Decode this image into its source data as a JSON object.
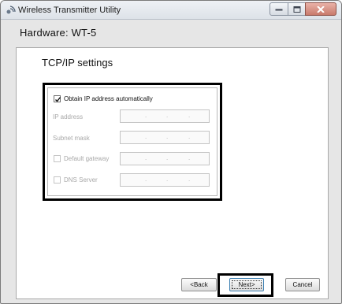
{
  "window": {
    "title": "Wireless Transmitter Utility",
    "app_icon": "wireless-transmitter-icon"
  },
  "header": {
    "hardware_label": "Hardware: WT-5"
  },
  "section": {
    "title": "TCP/IP settings"
  },
  "settings": {
    "obtain_auto": {
      "label": "Obtain IP address automatically",
      "checked": true
    },
    "ip_address": {
      "label": "IP address",
      "enabled": false
    },
    "subnet_mask": {
      "label": "Subnet mask",
      "enabled": false
    },
    "default_gateway": {
      "label": "Default gateway",
      "checked": false,
      "enabled": false
    },
    "dns_server": {
      "label": "DNS Server",
      "checked": false,
      "enabled": false
    }
  },
  "buttons": {
    "back_label": "<Back",
    "next_label": "Next>",
    "cancel_label": "Cancel"
  },
  "colors": {
    "highlight_border": "#000000",
    "disabled_text": "#a8a8a8",
    "panel_background": "#ffffff",
    "window_background": "#e6e6e6"
  }
}
